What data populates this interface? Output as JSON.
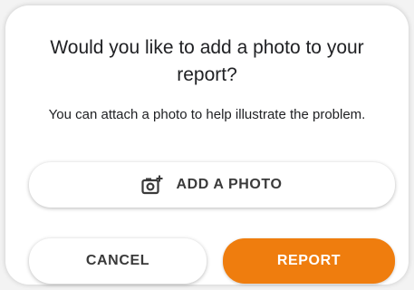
{
  "dialog": {
    "title": "Would you like to add a photo to your report?",
    "message": "You can attach a photo to help illustrate the problem.",
    "add_photo_label": "ADD A PHOTO",
    "add_photo_icon": "camera-add-icon",
    "cancel_label": "CANCEL",
    "report_label": "REPORT"
  },
  "colors": {
    "accent": "#ef7d0e",
    "text": "#202124",
    "button_text": "#3a3a3a"
  }
}
